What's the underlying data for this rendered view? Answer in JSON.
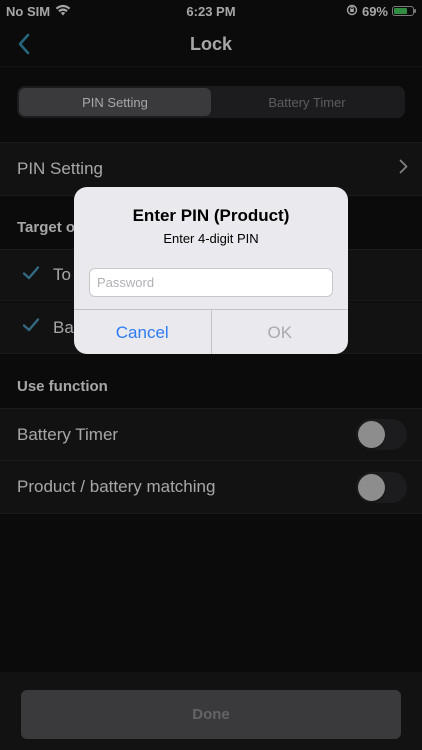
{
  "status_bar": {
    "carrier": "No SIM",
    "time": "6:23 PM",
    "battery_percent": "69%"
  },
  "nav": {
    "title": "Lock",
    "back_icon": "chevron-left-icon"
  },
  "segments": [
    {
      "label": "PIN Setting",
      "active": true
    },
    {
      "label": "Battery Timer",
      "active": false
    }
  ],
  "pin_setting_row": {
    "label": "PIN Setting"
  },
  "target_section": {
    "header": "Target o",
    "items": [
      {
        "label": "To",
        "checked": true
      },
      {
        "label": "Ba",
        "checked": true
      }
    ]
  },
  "use_function": {
    "header": "Use function",
    "items": [
      {
        "label": "Battery Timer",
        "enabled": false
      },
      {
        "label": "Product / battery matching",
        "enabled": false
      }
    ]
  },
  "done_button": {
    "label": "Done"
  },
  "alert": {
    "title": "Enter PIN (Product)",
    "message": "Enter 4-digit PIN",
    "input_value": "",
    "input_placeholder": "Password",
    "cancel_label": "Cancel",
    "ok_label": "OK"
  },
  "colors": {
    "background": "#121212",
    "row": "#1c1c1e",
    "accent_check": "#4fa3c7",
    "alert_button_blue": "#2d7cf6",
    "battery_green": "#4cd964"
  }
}
